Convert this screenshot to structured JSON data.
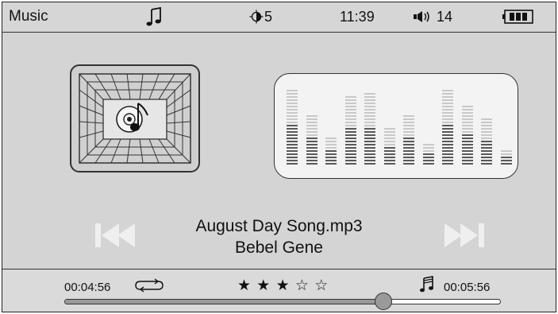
{
  "status_bar": {
    "app_title": "Music",
    "brightness": "5",
    "time": "11:39",
    "volume": "14",
    "icons": [
      "music-note-icon",
      "brightness-icon",
      "speaker-icon",
      "battery-icon"
    ]
  },
  "player": {
    "song_title": "August Day Song.mp3",
    "artist": "Bebel Gene",
    "prev_icon": "skip-previous-icon",
    "next_icon": "skip-next-icon",
    "equalizer_levels": [
      0.95,
      0.62,
      0.34,
      0.88,
      0.9,
      0.46,
      0.62,
      0.25,
      0.95,
      0.76,
      0.6,
      0.2
    ]
  },
  "bottom_bar": {
    "elapsed": "00:04:56",
    "total": "00:05:56",
    "rating_text": "★ ★ ★ ☆ ☆",
    "rating": 3,
    "rating_max": 5,
    "progress": 0.73
  },
  "colors": {
    "background": "#d4d4d4",
    "text": "#111111",
    "progress_fill": "#9a9a9a",
    "disabled_button": "#efefef"
  }
}
